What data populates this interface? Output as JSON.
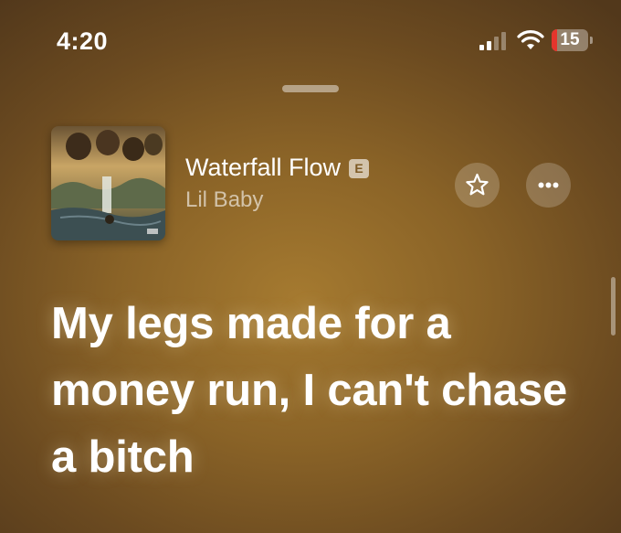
{
  "status_bar": {
    "time": "4:20",
    "battery_level": "15",
    "battery_fraction": 0.15,
    "signal_bars_active": 2,
    "signal_bars_total": 4,
    "battery_low_color": "#e5352c"
  },
  "now_playing": {
    "song_title": "Waterfall Flow",
    "explicit_badge": "E",
    "artist": "Lil Baby",
    "favorite_icon": "star-icon",
    "more_icon": "ellipsis-icon"
  },
  "lyrics": {
    "current_line": "My legs made for a money run, I can't chase a bitch"
  },
  "colors": {
    "background": "#8a6327",
    "text": "#ffffff",
    "secondary_text": "rgba(255,255,255,0.6)"
  }
}
